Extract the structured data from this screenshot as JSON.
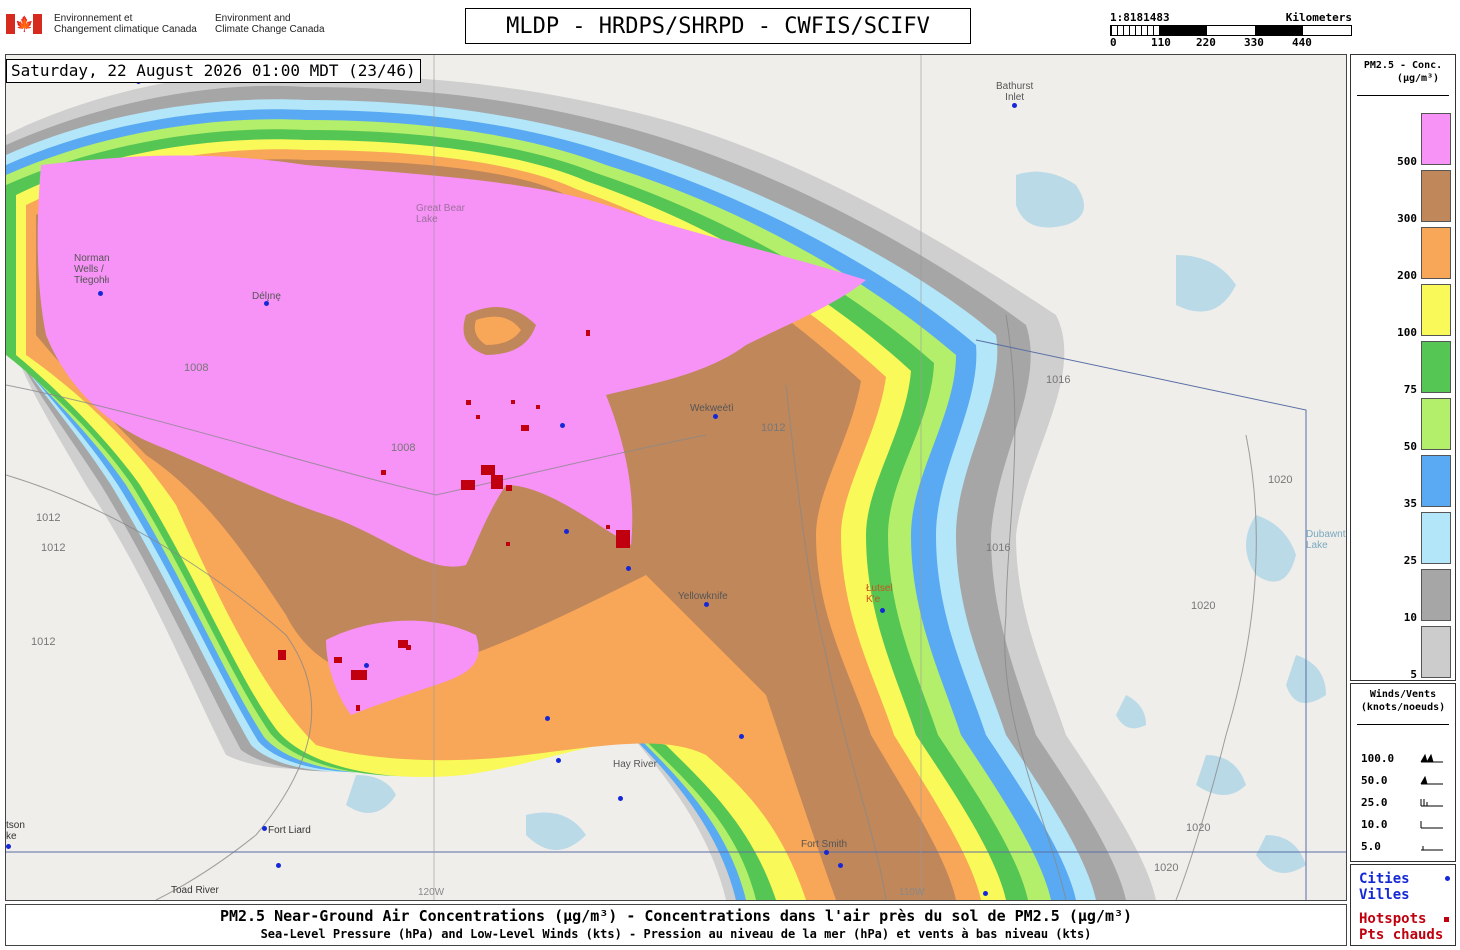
{
  "header": {
    "dept_fr_line1": "Environnement et",
    "dept_fr_line2": "Changement climatique Canada",
    "dept_en_line1": "Environment and",
    "dept_en_line2": "Climate Change Canada",
    "product_title": "MLDP - HRDPS/SHRPD - CWFIS/SCIFV"
  },
  "scale_bar": {
    "ratio": "1:8181483",
    "unit": "Kilometers",
    "ticks": [
      "0",
      "110",
      "220",
      "330",
      "440"
    ]
  },
  "map": {
    "timestamp": "Saturday, 22 August 2026 01:00 MDT (23/46)",
    "places": [
      {
        "name": "Bathurst\nInlet"
      },
      {
        "name": "Norman\nWells /\nTłegohłı"
      },
      {
        "name": "Délı̨nę"
      },
      {
        "name": "Great Bear\nLake"
      },
      {
        "name": "Wekweètì"
      },
      {
        "name": "Yellowknife"
      },
      {
        "name": "Łutsel\nK'e"
      },
      {
        "name": "Hay River"
      },
      {
        "name": "Fort Liard"
      },
      {
        "name": "Fort Smith"
      },
      {
        "name": "Toad River"
      },
      {
        "name": "tson\nke"
      },
      {
        "name": "Dubawnt\nLake"
      }
    ],
    "isobars": [
      "1008",
      "1008",
      "1012",
      "1012",
      "1012",
      "1012",
      "1016",
      "1016",
      "1020",
      "1020",
      "1020",
      "1020"
    ],
    "longitudes": [
      "120W",
      "110W"
    ]
  },
  "legend_pm25": {
    "title_line1": "PM2.5 - Conc.",
    "title_line2": "(µg/m³)",
    "classes": [
      {
        "label": "500",
        "color": "#f792f7"
      },
      {
        "label": "300",
        "color": "#c0875a"
      },
      {
        "label": "200",
        "color": "#f8a658"
      },
      {
        "label": "100",
        "color": "#f9f95a"
      },
      {
        "label": "75",
        "color": "#55c653"
      },
      {
        "label": "50",
        "color": "#b3ef6a"
      },
      {
        "label": "35",
        "color": "#59aaf2"
      },
      {
        "label": "25",
        "color": "#b3e6f8"
      },
      {
        "label": "10",
        "color": "#a6a6a6"
      },
      {
        "label": "5",
        "color": "#cccccc"
      }
    ]
  },
  "legend_wind": {
    "title_line1": "Winds/Vents",
    "title_line2": "(knots/noeuds)",
    "rows": [
      "100.0",
      "50.0",
      "25.0",
      "10.0",
      "5.0"
    ]
  },
  "legend_symbols": {
    "cities_en": "Cities",
    "cities_fr": "Villes",
    "city_color": "#1528d8",
    "hotspots_en": "Hotspots",
    "hotspots_fr": "Pts chauds",
    "hotspot_color": "#c0000e"
  },
  "footer": {
    "line1": "PM2.5 Near-Ground Air Concentrations (µg/m³) - Concentrations dans l'air près du sol de PM2.5 (µg/m³)",
    "line2": "Sea-Level Pressure (hPa) and Low-Level Winds (kts) - Pression au niveau de la mer (hPa) et vents à bas niveau (kts)"
  }
}
